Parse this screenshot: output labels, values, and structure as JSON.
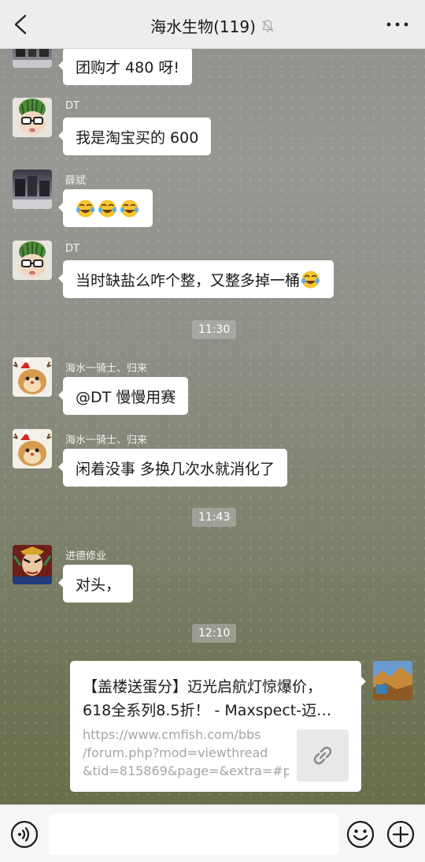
{
  "header": {
    "title": "海水生物(119)",
    "icons": {
      "back": "chevron-left-icon",
      "mute": "muted-bell-icon",
      "more": "more-dots-icon"
    }
  },
  "messages": [
    {
      "sender": "",
      "text": "团购才 480 呀!",
      "avatar": "photo-avatar"
    },
    {
      "sender": "DT",
      "text": "我是淘宝买的 600",
      "avatar": "watermelon-boy-avatar"
    },
    {
      "sender": "薛斌",
      "text": "",
      "emojis": [
        "laughing-tears-emoji",
        "laughing-tears-emoji",
        "laughing-tears-emoji"
      ],
      "avatar": "photo-avatar"
    },
    {
      "sender": "DT",
      "text": "当时缺盐么咋个整，又整多掉一桶",
      "trailing_emoji": "laughing-tears-emoji",
      "avatar": "watermelon-boy-avatar"
    },
    {
      "sender": "海水一骑士、归来",
      "text": "@DT  慢慢用赛",
      "avatar": "christmas-hamster-avatar"
    },
    {
      "sender": "海水一骑士、归来",
      "text": "闲着没事 多换几次水就消化了",
      "avatar": "christmas-hamster-avatar"
    },
    {
      "sender": "进德修业",
      "text": "对头，",
      "avatar": "opera-mask-avatar"
    }
  ],
  "times": [
    "11:30",
    "11:43",
    "12:10"
  ],
  "link_card": {
    "title_line1": "【盖楼送蛋分】迈光启航灯惊爆价，",
    "title_line2": "618全系列8.5折！ - Maxspect-迈…",
    "url_line1": "https://www.cmfish.com/bbs",
    "url_line2": "/forum.php?mod=viewthread",
    "url_line3": "&tid=815869&page=&extra=#p…",
    "icon": "link-icon"
  },
  "bottom_bar": {
    "input_value": "",
    "icons": [
      "voice-icon",
      "emoji-icon",
      "plus-icon"
    ]
  },
  "colors": {
    "header_bg": "#ededed",
    "bubble_bg": "#ffffff",
    "bottom_bg": "#f6f6f6"
  }
}
